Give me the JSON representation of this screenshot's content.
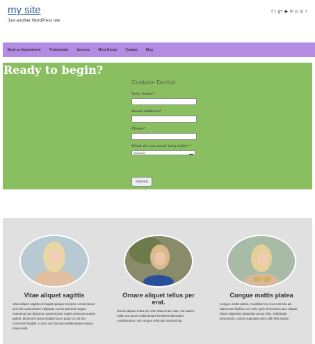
{
  "header": {
    "site_title": "my site",
    "tagline": "Just another WordPress site",
    "social_icons": [
      "facebook-icon",
      "twitter-icon",
      "google-plus-icon",
      "youtube-icon",
      "linkedin-icon",
      "pinterest-icon",
      "instagram-icon",
      "tumblr-icon"
    ],
    "social_glyphs": [
      "f",
      "t",
      "g+",
      "▶",
      "in",
      "p",
      "◎",
      "t"
    ]
  },
  "nav": {
    "items": [
      "Book an Appointment",
      "Testimonials",
      "Services",
      "Meet Doctor",
      "Contact",
      "Blog"
    ]
  },
  "cta": {
    "heading": "Ready to begin?",
    "form": {
      "title": "Contace Doctor",
      "name_label": "Your Name",
      "email_label": "Email Address",
      "phone_label": "Phone",
      "help_label": "What do you need help with?",
      "required_mark": "*",
      "help_select_value": "Dot-Doctor",
      "submit_label": "Submit"
    }
  },
  "features": [
    {
      "title": "Vitae aliquet sagittis",
      "text": "Vitae aliquet sagittis at feugiat quisque inceptos consectetuer sed nisl consectetuer vulputate cursus placerat magna maecenas dui dictumst. Laoreet justo mattis senectus mauris aptent. Morbi nisl luctus Nullam lacus quam Ut est hec commodo fringilla. Luctus nec faucibus pellentesque massa malesuada"
    },
    {
      "title": "Ornare aliquet tellus per erat.",
      "text": "Ornare aliquet tellus per erat. Maecenas vitae, est sapien nulla mus lacus mollis dictum hendrerit bibendum condimentum, nisl congue vehicula euismod dui."
    },
    {
      "title": "Congue mattis platea",
      "text": "Congue mattis platea. Curabitur leo eros molestie ad. Maecenas facilisis non velit. Quis elementum arcu aliquet fames dignissim phasellus auctor felis, sollicitudin elementum, cursus vulputate dolor nibh felis metus."
    }
  ]
}
